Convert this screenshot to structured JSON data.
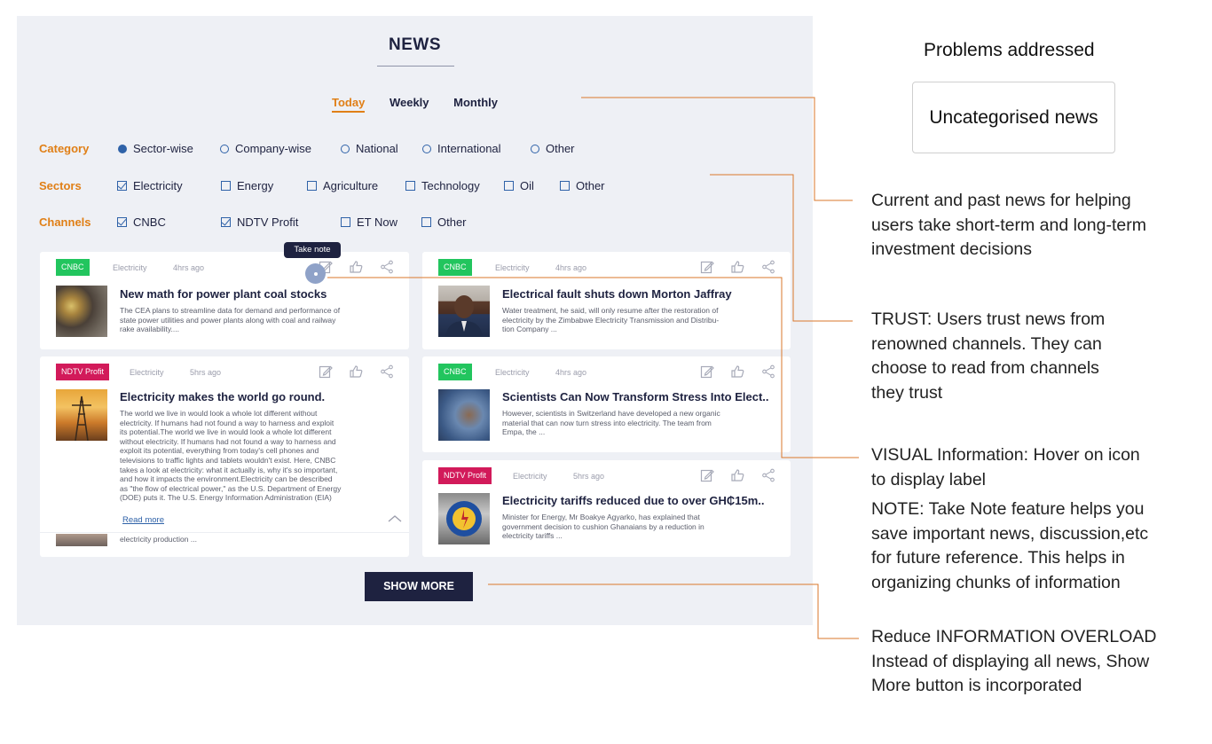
{
  "news": {
    "title": "NEWS",
    "periods": [
      "Today",
      "Weekly",
      "Monthly"
    ],
    "active_period": "Today",
    "filters": {
      "category": {
        "label": "Category",
        "options": [
          "Sector-wise",
          "Company-wise",
          "National",
          "International",
          "Other"
        ],
        "selected": "Sector-wise"
      },
      "sectors": {
        "label": "Sectors",
        "options": [
          "Electricity",
          "Energy",
          "Agriculture",
          "Technology",
          "Oil",
          "Other"
        ],
        "checked": [
          "Electricity"
        ]
      },
      "channels": {
        "label": "Channels",
        "options": [
          "CNBC",
          "NDTV Profit",
          "ET Now",
          "Other"
        ],
        "checked": [
          "CNBC",
          "NDTV Profit"
        ]
      }
    },
    "tooltip": "Take note",
    "cards": [
      {
        "source": "CNBC",
        "source_color": "#22c55e",
        "category": "Electricity",
        "time": "4hrs ago",
        "headline": "New math for power plant coal stocks",
        "excerpt": [
          "The CEA plans to streamline data for demand and performance of",
          "state power utilities and power plants along with coal and railway",
          "rake availability...."
        ]
      },
      {
        "source": "NDTV Profit",
        "source_color": "#d21a5a",
        "category": "Electricity",
        "time": "5hrs ago",
        "headline": "Electricity makes the world go round.",
        "excerpt": [
          "The world we live in would look a whole lot different without",
          "electricity. If humans had not found a way to harness and exploit",
          "its potential.The world we live in would look a whole lot different",
          "without electricity. If humans had not found a way to harness and",
          "exploit its potential, everything from today's cell phones and",
          "televisions to traffic lights and tablets wouldn't exist. Here, CNBC",
          "takes a look at electricity: what it actually is, why it's so important,",
          "and how it impacts the environment.Electricity can be described",
          "as \"the flow of electrical power,\" as the U.S. Department of Energy",
          "(DOE) puts it. The U.S. Energy Information Administration (EIA)"
        ],
        "read_more": "Read more",
        "underlying_text": "electricity production ..."
      },
      {
        "source": "CNBC",
        "source_color": "#22c55e",
        "category": "Electricity",
        "time": "4hrs ago",
        "headline": "Electrical fault shuts down Morton Jaffray",
        "excerpt": [
          "Water treatment, he said, will only resume after the restoration of",
          "electricity by the Zimbabwe Electricity Transmission and Distribu-",
          "tion Company ..."
        ]
      },
      {
        "source": "CNBC",
        "source_color": "#22c55e",
        "category": "Electricity",
        "time": "4hrs ago",
        "headline": "Scientists Can Now Transform Stress Into Elect..",
        "excerpt": [
          "However, scientists in Switzerland have developed a new organic",
          "material that can now turn stress into electricity. The team from",
          "Empa, the ..."
        ]
      },
      {
        "source": "NDTV Profit",
        "source_color": "#d21a5a",
        "category": "Electricity",
        "time": "5hrs ago",
        "headline": "Electricity tariffs reduced due to over GH₵15m..",
        "excerpt": [
          "Minister for Energy, Mr Boakye Agyarko, has explained that",
          "government decision to cushion Ghanaians by a reduction in",
          "electricity tariffs ..."
        ]
      }
    ],
    "show_more": "SHOW MORE"
  },
  "annotations": {
    "title": "Problems addressed",
    "chip": "Uncategorised news",
    "notes": [
      [
        "Current and past news for helping",
        "users take short-term and long-term",
        "investment decisions"
      ],
      [
        "TRUST: Users trust news from",
        "renowned channels. They can",
        "choose to read from channels",
        "they trust"
      ],
      [
        "VISUAL Information: Hover on icon",
        "to display label"
      ],
      [
        "NOTE: Take Note feature helps you",
        "save important news, discussion,etc",
        "for future reference. This helps in",
        "organizing chunks of information"
      ],
      [
        "Reduce INFORMATION OVERLOAD",
        "Instead of displaying all news, Show",
        "More button is incorporated"
      ]
    ],
    "connector_color": "#d9772b"
  }
}
